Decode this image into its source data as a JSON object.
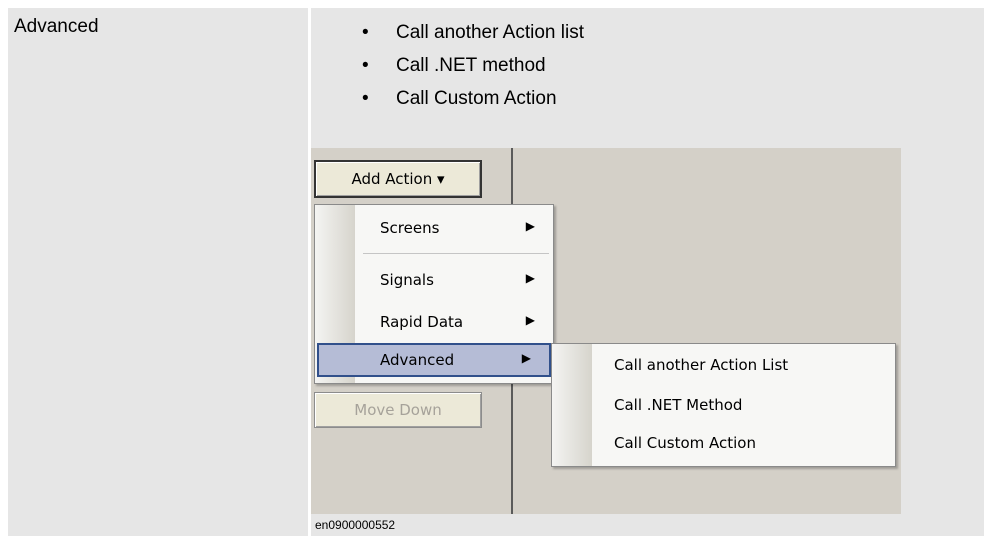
{
  "table": {
    "row_label": "Advanced",
    "bullets": [
      "Call another Action list",
      "Call .NET method",
      "Call Custom Action"
    ]
  },
  "screenshot": {
    "add_action_button": "Add Action ▾",
    "move_down_button": "Move Down",
    "menu": [
      {
        "label": "Screens",
        "arrow": "▶"
      },
      {
        "label": "Signals",
        "arrow": "▶"
      },
      {
        "label": "Rapid Data",
        "arrow": "▶"
      },
      {
        "label": "Advanced",
        "arrow": "▶"
      }
    ],
    "submenu": [
      "Call another Action List",
      "Call .NET Method",
      "Call Custom Action"
    ]
  },
  "caption": "en0900000552"
}
